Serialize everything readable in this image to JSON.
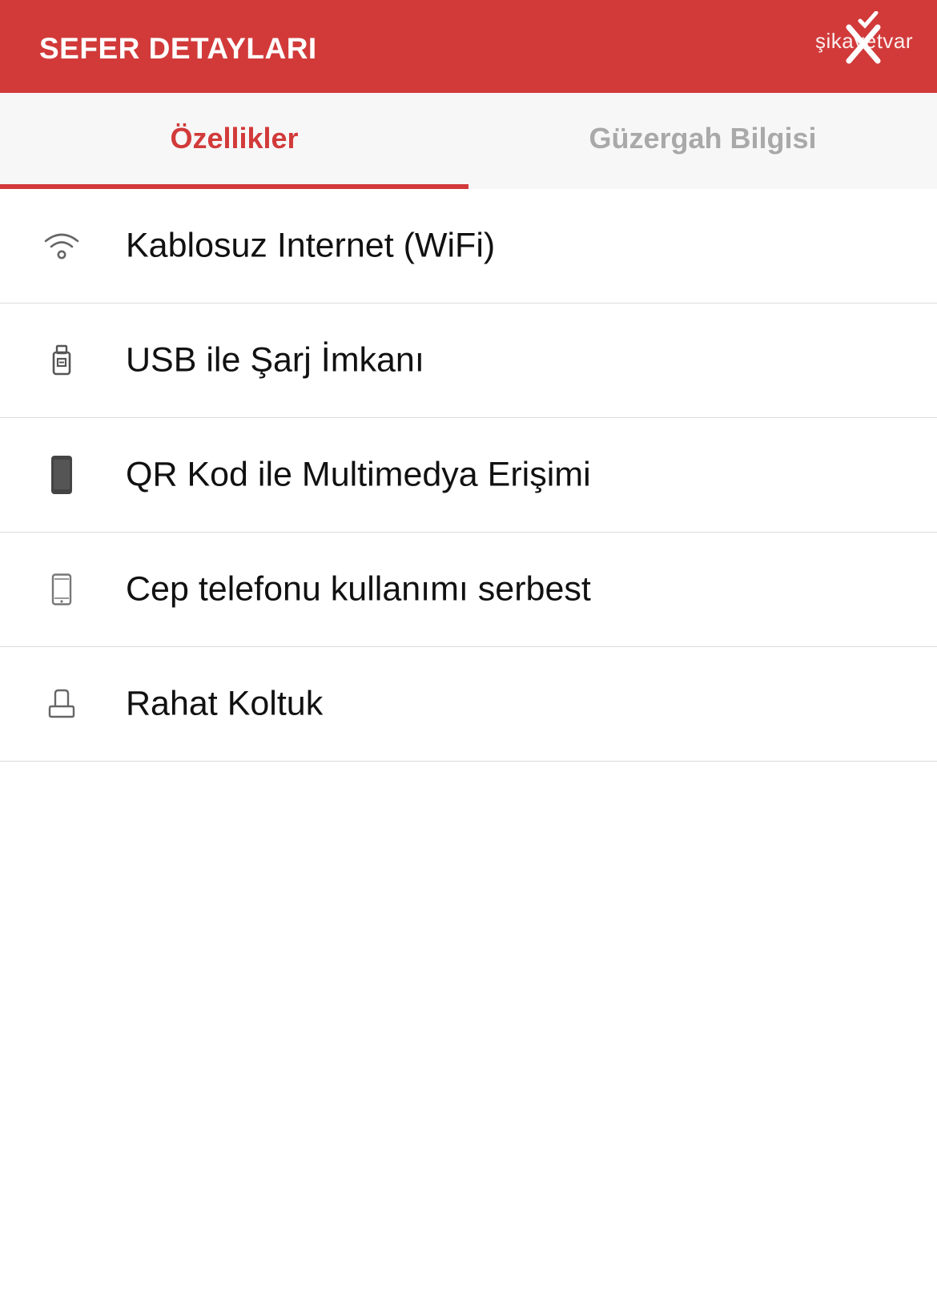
{
  "header": {
    "title": "SEFER DETAYLARI",
    "watermark": "şikayetvar",
    "background_color": "#d23a3a"
  },
  "tabs": [
    {
      "label": "Özellikler",
      "active": true
    },
    {
      "label": "Güzergah Bilgisi",
      "active": false
    }
  ],
  "accent_color": "#d23a3a",
  "features": [
    {
      "label": "Kablosuz Internet (WiFi)",
      "icon": "wifi-icon"
    },
    {
      "label": "USB ile Şarj İmkanı",
      "icon": "usb-icon"
    },
    {
      "label": "QR Kod ile Multimedya Erişimi",
      "icon": "tablet-icon"
    },
    {
      "label": "Cep telefonu kullanımı serbest",
      "icon": "mobile-phone-icon"
    },
    {
      "label": "Rahat Koltuk",
      "icon": "seat-icon"
    }
  ]
}
